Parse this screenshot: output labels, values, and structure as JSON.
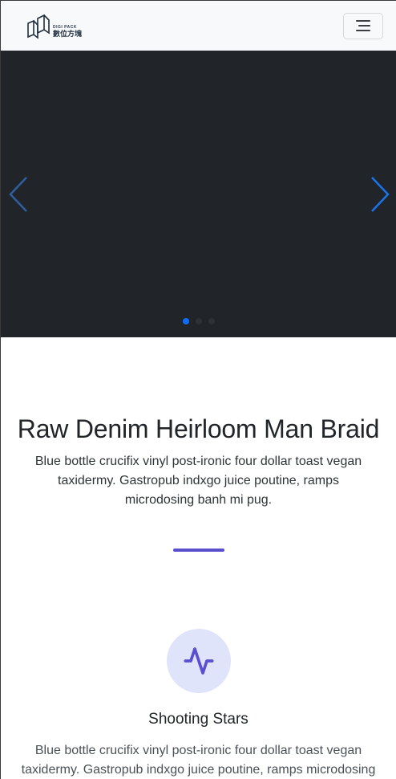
{
  "navbar": {
    "brand_en": "DIGI PACK",
    "brand_zh": "數位方塊",
    "logo_icon": "cube-logo-icon",
    "toggler_icon": "menu-icon"
  },
  "carousel": {
    "prev_icon": "chevron-left-icon",
    "next_icon": "chevron-right-icon",
    "slide_count": 3,
    "active_slide": 1
  },
  "hero": {
    "title": "Raw Denim Heirloom Man Braid",
    "text": "Blue bottle crucifix vinyl post-ironic four dollar toast vegan taxidermy. Gastropub indxgo juice poutine, ramps microdosing banh mi pug."
  },
  "feature": {
    "icon": "activity-pulse-icon",
    "title": "Shooting Stars",
    "text": "Blue bottle crucifix vinyl post-ironic four dollar toast vegan taxidermy. Gastropub indxgo juice poutine, ramps microdosing banh mi pug."
  },
  "colors": {
    "accent": "#5a4fcf",
    "carousel_bg": "#212529",
    "indicator_active": "#0d6efd",
    "icon_bg": "#e0e4fb"
  }
}
